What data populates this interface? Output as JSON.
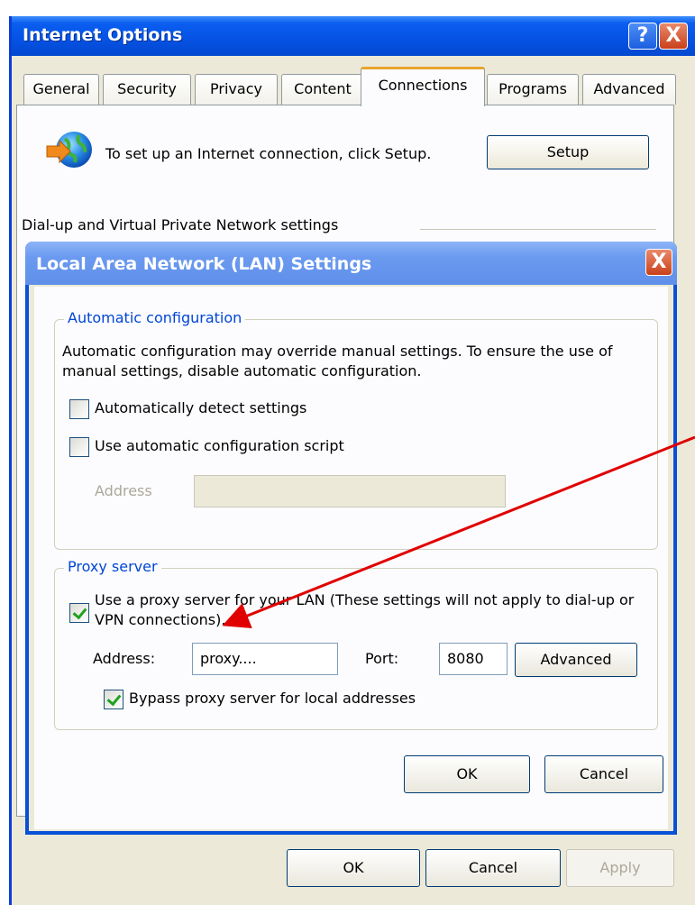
{
  "outer": {
    "title": "Internet Options",
    "help_glyph": "?",
    "close_glyph": "X",
    "tabs": [
      "General",
      "Security",
      "Privacy",
      "Content",
      "Connections",
      "Programs",
      "Advanced"
    ],
    "setup_text": "To set up an Internet connection, click Setup.",
    "setup_label": "Setup",
    "dialup_label": "Dial-up and Virtual Private Network settings",
    "ok_label": "OK",
    "cancel_label": "Cancel",
    "apply_label": "Apply"
  },
  "lan": {
    "title": "Local Area Network (LAN) Settings",
    "close_glyph": "X",
    "auto": {
      "group_label": "Automatic configuration",
      "description": "Automatic configuration may override manual settings.  To ensure the use of manual settings, disable automatic configuration.",
      "detect_label": "Automatically detect settings",
      "detect_checked": false,
      "script_label": "Use automatic configuration script",
      "script_checked": false,
      "address_label": "Address",
      "address_value": ""
    },
    "proxy": {
      "group_label": "Proxy server",
      "use_proxy_label": "Use a proxy server for your LAN (These settings will not apply to dial-up or VPN connections).",
      "use_proxy_checked": true,
      "address_label": "Address:",
      "address_value": "proxy....",
      "port_label": "Port:",
      "port_value": "8080",
      "advanced_label": "Advanced",
      "bypass_label": "Bypass proxy server for local addresses",
      "bypass_checked": true
    },
    "ok_label": "OK",
    "cancel_label": "Cancel"
  },
  "colors": {
    "titlebar_blue": "#0552e3",
    "dialog_border": "#0850d8",
    "group_label": "#0046d5",
    "arrow": "#e00000"
  },
  "icons": {
    "connection": "globe-connection-icon"
  }
}
